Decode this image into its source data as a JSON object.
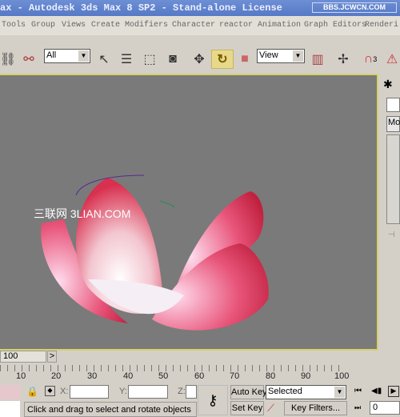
{
  "title": "ax - Autodesk 3ds Max 8 SP2  - Stand-alone License",
  "watermark_top": "BBS.JCWCN.COM",
  "menu": [
    "Tools",
    "Group",
    "Views",
    "Create",
    "Modifiers",
    "Character",
    "reactor",
    "Animation",
    "Graph Editors",
    "Renderi"
  ],
  "toolbar": {
    "selection_filter": "All",
    "coord_system": "View",
    "snap_label": "3"
  },
  "viewport": {
    "watermark": "三联网 3LIAN.COM",
    "bg": "#7a7a7a",
    "border": "#d8d26a"
  },
  "command_panel": {
    "field": "Mo"
  },
  "time_slider": {
    "value": "100",
    "next": ">"
  },
  "ruler_ticks": [
    "10",
    "20",
    "30",
    "40",
    "50",
    "60",
    "70",
    "80",
    "90",
    "100"
  ],
  "status": {
    "x_label": "X:",
    "y_label": "Y:",
    "z_label": "Z:",
    "prompt": "Click and drag to select and rotate objects",
    "auto_key": "Auto Key",
    "set_key": "Set Key",
    "key_mode": "Selected",
    "key_filters": "Key Filters...",
    "frame": "0"
  }
}
